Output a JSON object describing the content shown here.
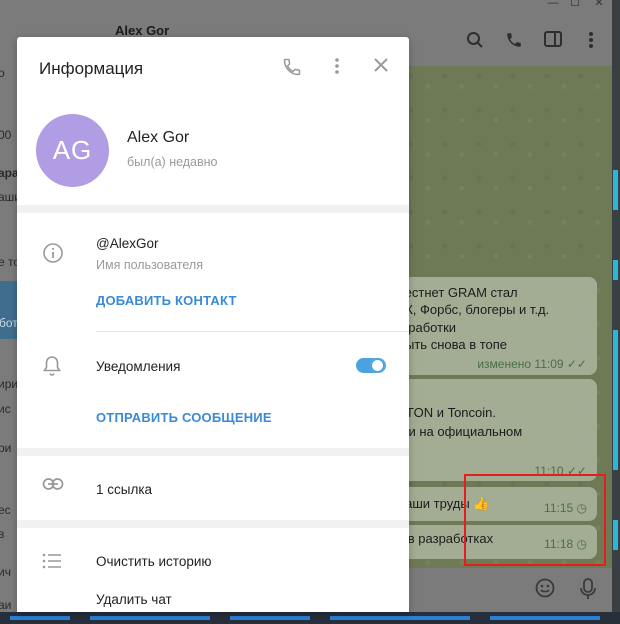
{
  "background": {
    "sidebar_fragments": [
      "о",
      "00",
      "ара",
      "аши",
      "е то",
      "бот",
      "ири",
      "ис",
      "ри",
      "ес",
      "в",
      "ич",
      "аи"
    ],
    "chat_title": "Alex Gor",
    "window_controls": [
      "—",
      "☐",
      "✕"
    ],
    "header_icons": [
      "search-icon",
      "phone-icon",
      "sidebar-toggle-icon",
      "more-icon"
    ],
    "messages": [
      {
        "lines": [
          "й тестнет GRAM стал",
          "РБК, Форбс, блогеры и т.д.",
          "разработки",
          "т быть снова в топе"
        ],
        "meta": "изменено 11:09 ✓✓"
      },
      {
        "lines": [
          "по TON и Toncoin.",
          "айти на официальном"
        ],
        "meta": "11:10 ✓✓"
      },
      {
        "lines": [
          "ь ваши труды 👍"
        ],
        "meta": "11:15 ◷"
      },
      {
        "lines": [
          "ам в разработках"
        ],
        "meta": "11:18 ◷"
      }
    ]
  },
  "modal": {
    "title": "Информация",
    "avatar_initials": "AG",
    "avatar_color": "#b09de4",
    "name": "Alex Gor",
    "status": "был(а) недавно",
    "username": "@AlexGor",
    "username_caption": "Имя пользователя",
    "add_contact": "ДОБАВИТЬ КОНТАКТ",
    "notifications_label": "Уведомления",
    "notifications_on": true,
    "send_message": "ОТПРАВИТЬ СООБЩЕНИЕ",
    "links": "1 ссылка",
    "clear_history": "Очистить историю",
    "delete_chat": "Удалить чат"
  },
  "accent_color": "#3a8ad6",
  "annotation_color": "#e51d1d"
}
